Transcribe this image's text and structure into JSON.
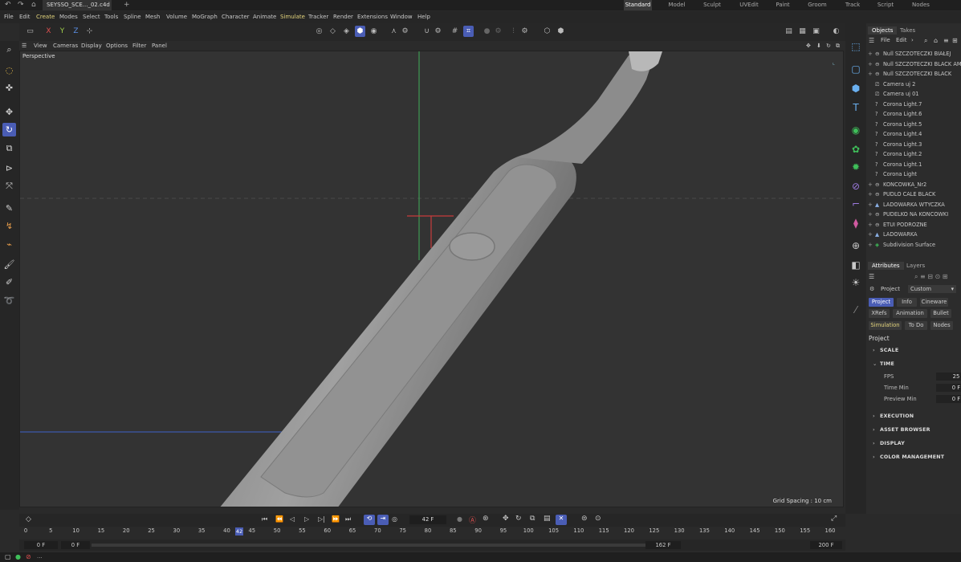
{
  "titlebar": {
    "doc_tab": "SEYSSO_SCE..._02.c4d *",
    "add": "+",
    "layouts": [
      "Standard",
      "Model",
      "Sculpt",
      "UVEdit",
      "Paint",
      "Groom",
      "Track",
      "Script",
      "Nodes"
    ],
    "active_layout": "Standard"
  },
  "menubar": [
    "File",
    "Edit",
    "Create",
    "Modes",
    "Select",
    "Tools",
    "Spline",
    "Mesh",
    "Volume",
    "MoGraph",
    "Character",
    "Animate",
    "Simulate",
    "Tracker",
    "Render",
    "Extensions",
    "Window",
    "Help"
  ],
  "toolbar": {
    "axes": [
      "X",
      "Y",
      "Z"
    ]
  },
  "viewport_menu": [
    "View",
    "Cameras",
    "Display",
    "Options",
    "Filter",
    "Panel"
  ],
  "viewport": {
    "label": "Perspective",
    "grid_spacing": "Grid Spacing : 10 cm",
    "accent": "#4a5db5"
  },
  "objects_panel": {
    "tabs": [
      "Objects",
      "Takes"
    ],
    "menu": [
      "File",
      "Edit"
    ],
    "items": [
      {
        "label": "Null SZCZOTECZKI BIAŁEJ",
        "icon": "null-icon",
        "exp": "+"
      },
      {
        "label": "Null SZCZOTECZKI BLACK AM",
        "icon": "null-icon",
        "exp": "+"
      },
      {
        "label": "Null SZCZOTECZKI BLACK",
        "icon": "null-icon",
        "exp": "+"
      },
      {
        "label": "Camera uj 2",
        "icon": "camera-icon",
        "exp": ""
      },
      {
        "label": "Camera uj 01",
        "icon": "camera-icon",
        "exp": ""
      },
      {
        "label": "Corona Light.7",
        "icon": "light-icon",
        "exp": ""
      },
      {
        "label": "Corona Light.6",
        "icon": "light-icon",
        "exp": ""
      },
      {
        "label": "Corona Light.5",
        "icon": "light-icon",
        "exp": ""
      },
      {
        "label": "Corona Light.4",
        "icon": "light-icon",
        "exp": ""
      },
      {
        "label": "Corona Light.3",
        "icon": "light-icon",
        "exp": ""
      },
      {
        "label": "Corona Light.2",
        "icon": "light-icon",
        "exp": ""
      },
      {
        "label": "Corona Light.1",
        "icon": "light-icon",
        "exp": ""
      },
      {
        "label": "Corona Light",
        "icon": "light-icon",
        "exp": ""
      },
      {
        "label": "KONCOWKA_Nr2",
        "icon": "null-icon",
        "exp": "+"
      },
      {
        "label": "PUDLO CALE BLACK",
        "icon": "null-icon",
        "exp": "+"
      },
      {
        "label": "LADOWARKA WTYCZKA",
        "icon": "polygon-icon",
        "exp": "+"
      },
      {
        "label": "PUDELKO NA KONCOWKI",
        "icon": "null-icon",
        "exp": "+"
      },
      {
        "label": "ETUI PODROZNE",
        "icon": "null-icon",
        "exp": "+"
      },
      {
        "label": "LADOWARKA",
        "icon": "polygon-icon",
        "exp": "+"
      },
      {
        "label": "Subdivision Surface",
        "icon": "subdivision-icon",
        "exp": "+"
      }
    ]
  },
  "attributes_panel": {
    "tabs": [
      "Attributes",
      "Layers"
    ],
    "mode": "Project",
    "preset": "Custom",
    "chips_row1": [
      "Project",
      "Info",
      "Cineware"
    ],
    "chips_row2": [
      "XRefs",
      "Animation",
      "Bullet"
    ],
    "chips_row3": [
      "Simulation",
      "To Do",
      "Nodes"
    ],
    "heading": "Project",
    "sections": [
      "SCALE",
      "TIME",
      "EXECUTION",
      "ASSET BROWSER",
      "DISPLAY",
      "COLOR MANAGEMENT"
    ],
    "fields": [
      {
        "label": "FPS",
        "value": "25"
      },
      {
        "label": "Time Min",
        "value": "0 F"
      },
      {
        "label": "Preview Min",
        "value": "0 F"
      }
    ]
  },
  "timeline": {
    "current_frame": "42 F",
    "current_marker": "42"
  },
  "ruler": {
    "ticks": [
      "0",
      "5",
      "10",
      "15",
      "20",
      "25",
      "30",
      "35",
      "40",
      "45",
      "50",
      "55",
      "60",
      "65",
      "70",
      "75",
      "80",
      "85",
      "90",
      "95",
      "100",
      "105",
      "110",
      "115",
      "120",
      "125",
      "130",
      "135",
      "140",
      "145",
      "150",
      "155",
      "160"
    ]
  },
  "range": {
    "start": "0 F",
    "preview_start": "0 F",
    "preview_end": "162 F",
    "end": "200 F"
  },
  "statusbar": {
    "text": "..."
  }
}
